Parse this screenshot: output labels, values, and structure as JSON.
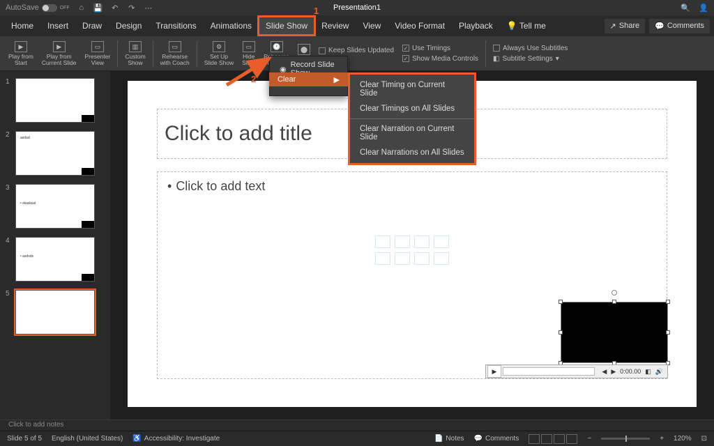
{
  "titlebar": {
    "autosave_label": "AutoSave",
    "autosave_state": "OFF",
    "doc_title": "Presentation1"
  },
  "tabs": {
    "items": [
      "Home",
      "Insert",
      "Draw",
      "Design",
      "Transitions",
      "Animations",
      "Slide Show",
      "Review",
      "View",
      "Video Format",
      "Playback",
      "Tell me"
    ],
    "active": "Slide Show",
    "share": "Share",
    "comments": "Comments"
  },
  "ribbon": {
    "play_from_start": "Play from\nStart",
    "play_from_current": "Play from\nCurrent Slide",
    "presenter_view": "Presenter\nView",
    "custom_show": "Custom\nShow",
    "rehearse_coach": "Rehearse\nwith Coach",
    "setup": "Set Up\nSlide Show",
    "hide": "Hide\nSlide",
    "rehearse_timings": "Rehearse\nTimings",
    "keep_updated": "Keep Slides Updated",
    "use_timings": "Use Timings",
    "show_media": "Show Media Controls",
    "always_subtitles": "Always Use Subtitles",
    "subtitle_settings": "Subtitle Settings"
  },
  "dropdown": {
    "record": "Record Slide Show",
    "clear": "Clear"
  },
  "submenu": {
    "item1": "Clear Timing on Current Slide",
    "item2": "Clear Timings on All Slides",
    "item3": "Clear Narration on Current Slide",
    "item4": "Clear Narrations on All Slides"
  },
  "annotations": {
    "one": "1",
    "two": "2"
  },
  "thumbs": [
    {
      "n": "1",
      "txt": ""
    },
    {
      "n": "2",
      "txt": "asdad"
    },
    {
      "n": "3",
      "txt": "• skaskasl"
    },
    {
      "n": "4",
      "txt": "• asdsds"
    },
    {
      "n": "5",
      "txt": ""
    }
  ],
  "slide": {
    "title_ph": "Click to add title",
    "body_ph": "Click to add text",
    "time": "0:00.00"
  },
  "notes": {
    "placeholder": "Click to add notes"
  },
  "status": {
    "indicator": "Slide 5 of 5",
    "lang": "English (United States)",
    "access": "Accessibility: Investigate",
    "notes": "Notes",
    "comments": "Comments",
    "zoom": "120%"
  }
}
